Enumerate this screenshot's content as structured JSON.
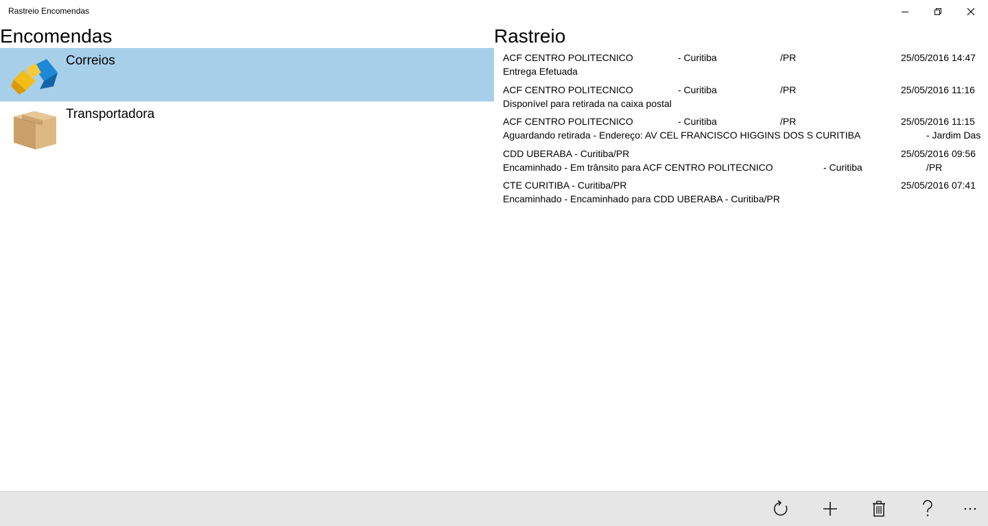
{
  "window": {
    "title": "Rastreio Encomendas"
  },
  "left_pane": {
    "heading": "Encomendas",
    "items": [
      {
        "label": "Correios",
        "icon": "correios-logo-icon",
        "selected": true
      },
      {
        "label": "Transportadora",
        "icon": "cardboard-box-icon",
        "selected": false
      }
    ]
  },
  "right_pane": {
    "heading": "Rastreio",
    "events": [
      {
        "loc_name": "ACF CENTRO POLITECNICO",
        "loc_city": "- Curitiba",
        "loc_state": "/PR",
        "datetime": "25/05/2016 14:47",
        "desc": "Entrega Efetuada",
        "desc_city": "",
        "desc_state": ""
      },
      {
        "loc_name": "ACF CENTRO POLITECNICO",
        "loc_city": "- Curitiba",
        "loc_state": "/PR",
        "datetime": "25/05/2016 11:16",
        "desc": "Disponível para retirada na caixa postal",
        "desc_city": "",
        "desc_state": ""
      },
      {
        "loc_name": "ACF CENTRO POLITECNICO",
        "loc_city": "- Curitiba",
        "loc_state": "/PR",
        "datetime": "25/05/2016 11:15",
        "desc": "Aguardando retirada - Endereço:  AV CEL FRANCISCO HIGGINS DOS S  CURITIBA",
        "desc_city": "",
        "desc_state": "- Jardim Das"
      },
      {
        "loc_name": "CDD UBERABA - Curitiba/PR",
        "loc_city": "",
        "loc_state": "",
        "datetime": "25/05/2016 09:56",
        "desc": "Encaminhado - Em trânsito para ACF CENTRO POLITECNICO",
        "desc_city": "- Curitiba",
        "desc_state": "/PR"
      },
      {
        "loc_name": "CTE CURITIBA - Curitiba/PR",
        "loc_city": "",
        "loc_state": "",
        "datetime": "25/05/2016 07:41",
        "desc": "Encaminhado - Encaminhado para CDD UBERABA - Curitiba/PR",
        "desc_city": "",
        "desc_state": ""
      }
    ]
  },
  "app_bar": {
    "buttons": [
      "refresh-icon",
      "add-icon",
      "delete-icon",
      "help-icon",
      "more-icon"
    ]
  },
  "colors": {
    "selected_item_bg": "#a8cfea",
    "app_bar_bg": "#e6e6e6"
  }
}
